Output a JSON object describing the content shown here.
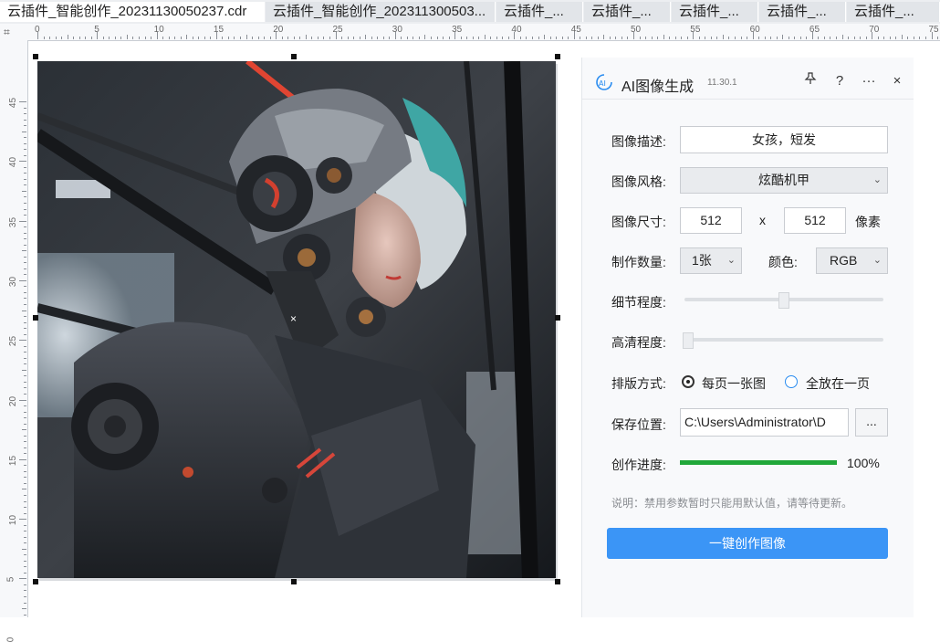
{
  "tabs": [
    {
      "label": "云插件_智能创作_20231130050237.cdr",
      "active": true
    },
    {
      "label": "云插件_智能创作_202311300503...",
      "active": false
    },
    {
      "label": "云插件_...",
      "active": false
    },
    {
      "label": "云插件_...",
      "active": false
    },
    {
      "label": "云插件_...",
      "active": false
    },
    {
      "label": "云插件_...",
      "active": false
    },
    {
      "label": "云插件_...",
      "active": false
    }
  ],
  "ruler": {
    "top_labels": [
      "0",
      "5",
      "10",
      "15",
      "20",
      "25",
      "30",
      "35",
      "40",
      "45",
      "50",
      "55",
      "60",
      "65",
      "70",
      "75"
    ],
    "left_labels": [
      "45",
      "40",
      "35",
      "30",
      "25",
      "20",
      "15",
      "10",
      "5",
      "0"
    ]
  },
  "panel": {
    "title": "AI图像生成",
    "badge": "AI",
    "version": "11.30.1",
    "header_icons": {
      "pin": "pin-icon",
      "help": "?",
      "more": "···",
      "close": "×"
    },
    "description_label": "图像描述:",
    "description_value": "女孩，短发",
    "style_label": "图像风格:",
    "style_value": "炫酷机甲",
    "size_label": "图像尺寸:",
    "width_value": "512",
    "size_separator": "x",
    "height_value": "512",
    "size_unit": "像素",
    "count_label": "制作数量:",
    "count_value": "1张",
    "color_label": "颜色:",
    "color_value": "RGB",
    "detail_label": "细节程度:",
    "detail_level": 0.5,
    "clarity_label": "高清程度:",
    "clarity_level": 0.0,
    "layout_label": "排版方式:",
    "layout_option_1": "每页一张图",
    "layout_option_2": "全放在一页",
    "layout_selected": 1,
    "save_label": "保存位置:",
    "save_path": "C:\\Users\\Administrator\\D",
    "browse_label": "...",
    "progress_label": "创作进度:",
    "progress_value": 1.0,
    "progress_text": "100%",
    "note": "说明：禁用参数暂时只能用默认值，请等待更新。",
    "create_button": "一键创作图像",
    "colors": {
      "accent": "#3b95f6",
      "progress": "#21a83a",
      "radio": "#2a8cf0"
    }
  }
}
